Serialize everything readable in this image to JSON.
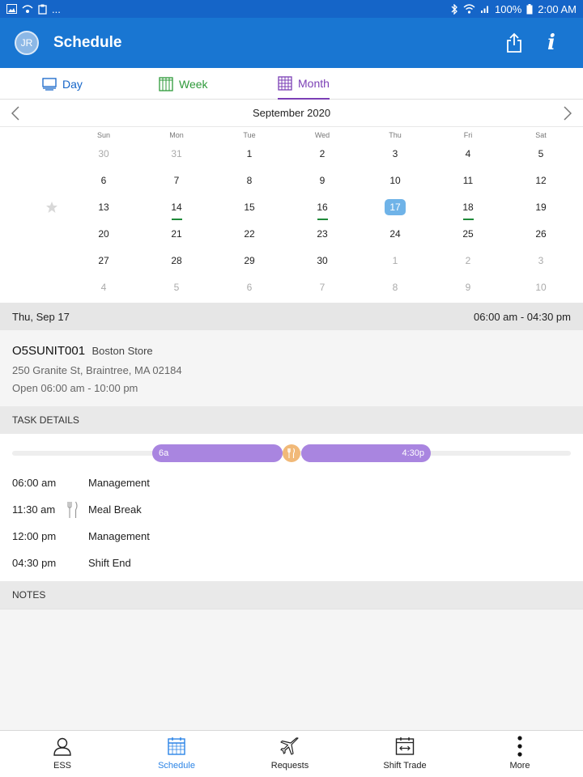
{
  "status_bar": {
    "battery": "100%",
    "time": "2:00 AM",
    "extra": "..."
  },
  "app_bar": {
    "avatar_initials": "JR",
    "title": "Schedule"
  },
  "view_tabs": [
    {
      "label": "Day",
      "color": "#1565c8"
    },
    {
      "label": "Week",
      "color": "#2e9a3a"
    },
    {
      "label": "Month",
      "color": "#7b3fb5",
      "selected": true
    }
  ],
  "calendar": {
    "month_label": "September 2020",
    "weekdays": [
      "Sun",
      "Mon",
      "Tue",
      "Wed",
      "Thu",
      "Fri",
      "Sat"
    ],
    "weeks": [
      [
        "30",
        "31",
        "1",
        "2",
        "3",
        "4",
        "5"
      ],
      [
        "6",
        "7",
        "8",
        "9",
        "10",
        "11",
        "12"
      ],
      [
        "13",
        "14",
        "15",
        "16",
        "17",
        "18",
        "19"
      ],
      [
        "20",
        "21",
        "22",
        "23",
        "24",
        "25",
        "26"
      ],
      [
        "27",
        "28",
        "29",
        "30",
        "1",
        "2",
        "3"
      ],
      [
        "4",
        "5",
        "6",
        "7",
        "8",
        "9",
        "10"
      ]
    ],
    "faded_cells": [
      "0-0",
      "0-1",
      "4-4",
      "4-5",
      "4-6",
      "5-0",
      "5-1",
      "5-2",
      "5-3",
      "5-4",
      "5-5",
      "5-6"
    ],
    "selected_cell": "2-4",
    "marked_cells": [
      "2-1",
      "2-3",
      "2-5"
    ],
    "starred_week": 2
  },
  "selected_day": {
    "date_label": "Thu, Sep 17",
    "shift_range": "06:00 am - 04:30 pm"
  },
  "store": {
    "id": "O5SUNIT001",
    "name": "Boston Store",
    "address": "250 Granite St, Braintree, MA 02184",
    "hours": "Open 06:00 am - 10:00 pm"
  },
  "task_details": {
    "header": "TASK DETAILS",
    "timeline_start_label": "6a",
    "timeline_end_label": "4:30p",
    "rows": [
      {
        "time": "06:00 am",
        "label": "Management",
        "icon": ""
      },
      {
        "time": "11:30 am",
        "label": "Meal Break",
        "icon": "fork-knife-icon"
      },
      {
        "time": "12:00 pm",
        "label": "Management",
        "icon": ""
      },
      {
        "time": "04:30 pm",
        "label": "Shift End",
        "icon": ""
      }
    ]
  },
  "notes": {
    "header": "NOTES"
  },
  "bottom_nav": [
    {
      "label": "ESS",
      "icon": "person-icon",
      "active": false
    },
    {
      "label": "Schedule",
      "icon": "calendar-icon",
      "active": true
    },
    {
      "label": "Requests",
      "icon": "airplane-icon",
      "active": false
    },
    {
      "label": "Shift Trade",
      "icon": "shift-trade-icon",
      "active": false
    },
    {
      "label": "More",
      "icon": "more-vertical-icon",
      "active": false
    }
  ],
  "colors": {
    "app_bar": "#1976d2",
    "accent_selected_day": "#6fb3e8",
    "timeline_purple": "#a985e0",
    "meal_break": "#f1b978",
    "event_marker": "#1f8a3a"
  }
}
